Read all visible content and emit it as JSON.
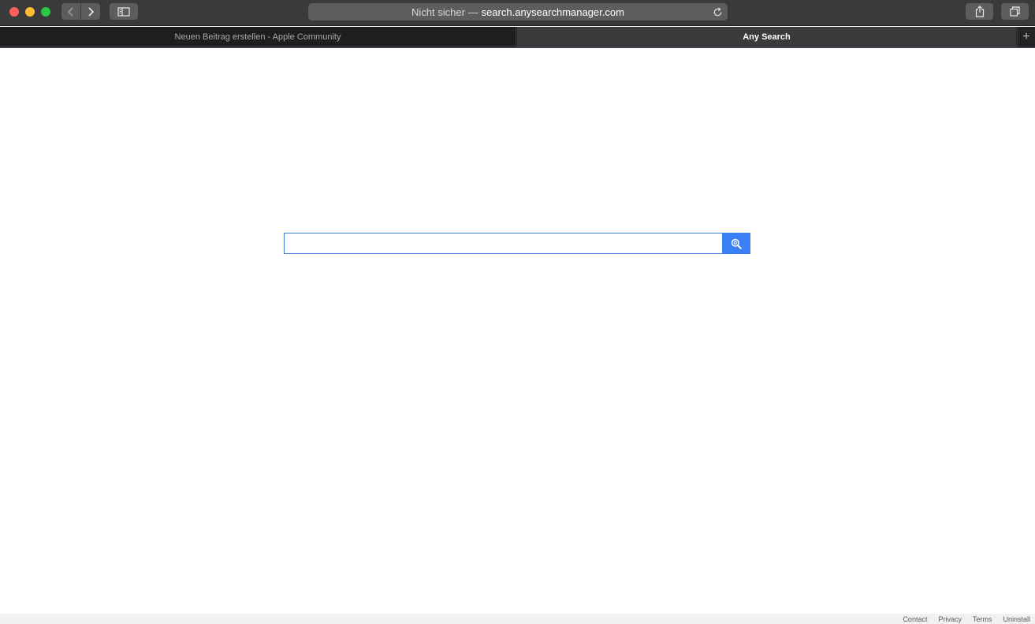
{
  "browser": {
    "address": {
      "insecure_label": "Nicht sicher —",
      "host": "search.anysearchmanager.com"
    },
    "tabs": [
      {
        "label": "Neuen Beitrag erstellen - Apple Community"
      },
      {
        "label": "Any Search"
      }
    ],
    "new_tab_label": "+"
  },
  "search": {
    "value": "",
    "placeholder": ""
  },
  "footer": {
    "links": [
      "Contact",
      "Privacy",
      "Terms",
      "Uninstall"
    ]
  },
  "colors": {
    "accent": "#3a7ff6",
    "toolbar": "#3a3a3c",
    "tabbar": "#232325"
  },
  "icons": {
    "back": "chevron-left-icon",
    "forward": "chevron-right-icon",
    "sidebar": "sidebar-icon",
    "reload": "reload-icon",
    "share": "share-icon",
    "tabs": "tabs-overview-icon",
    "search": "search-icon"
  }
}
